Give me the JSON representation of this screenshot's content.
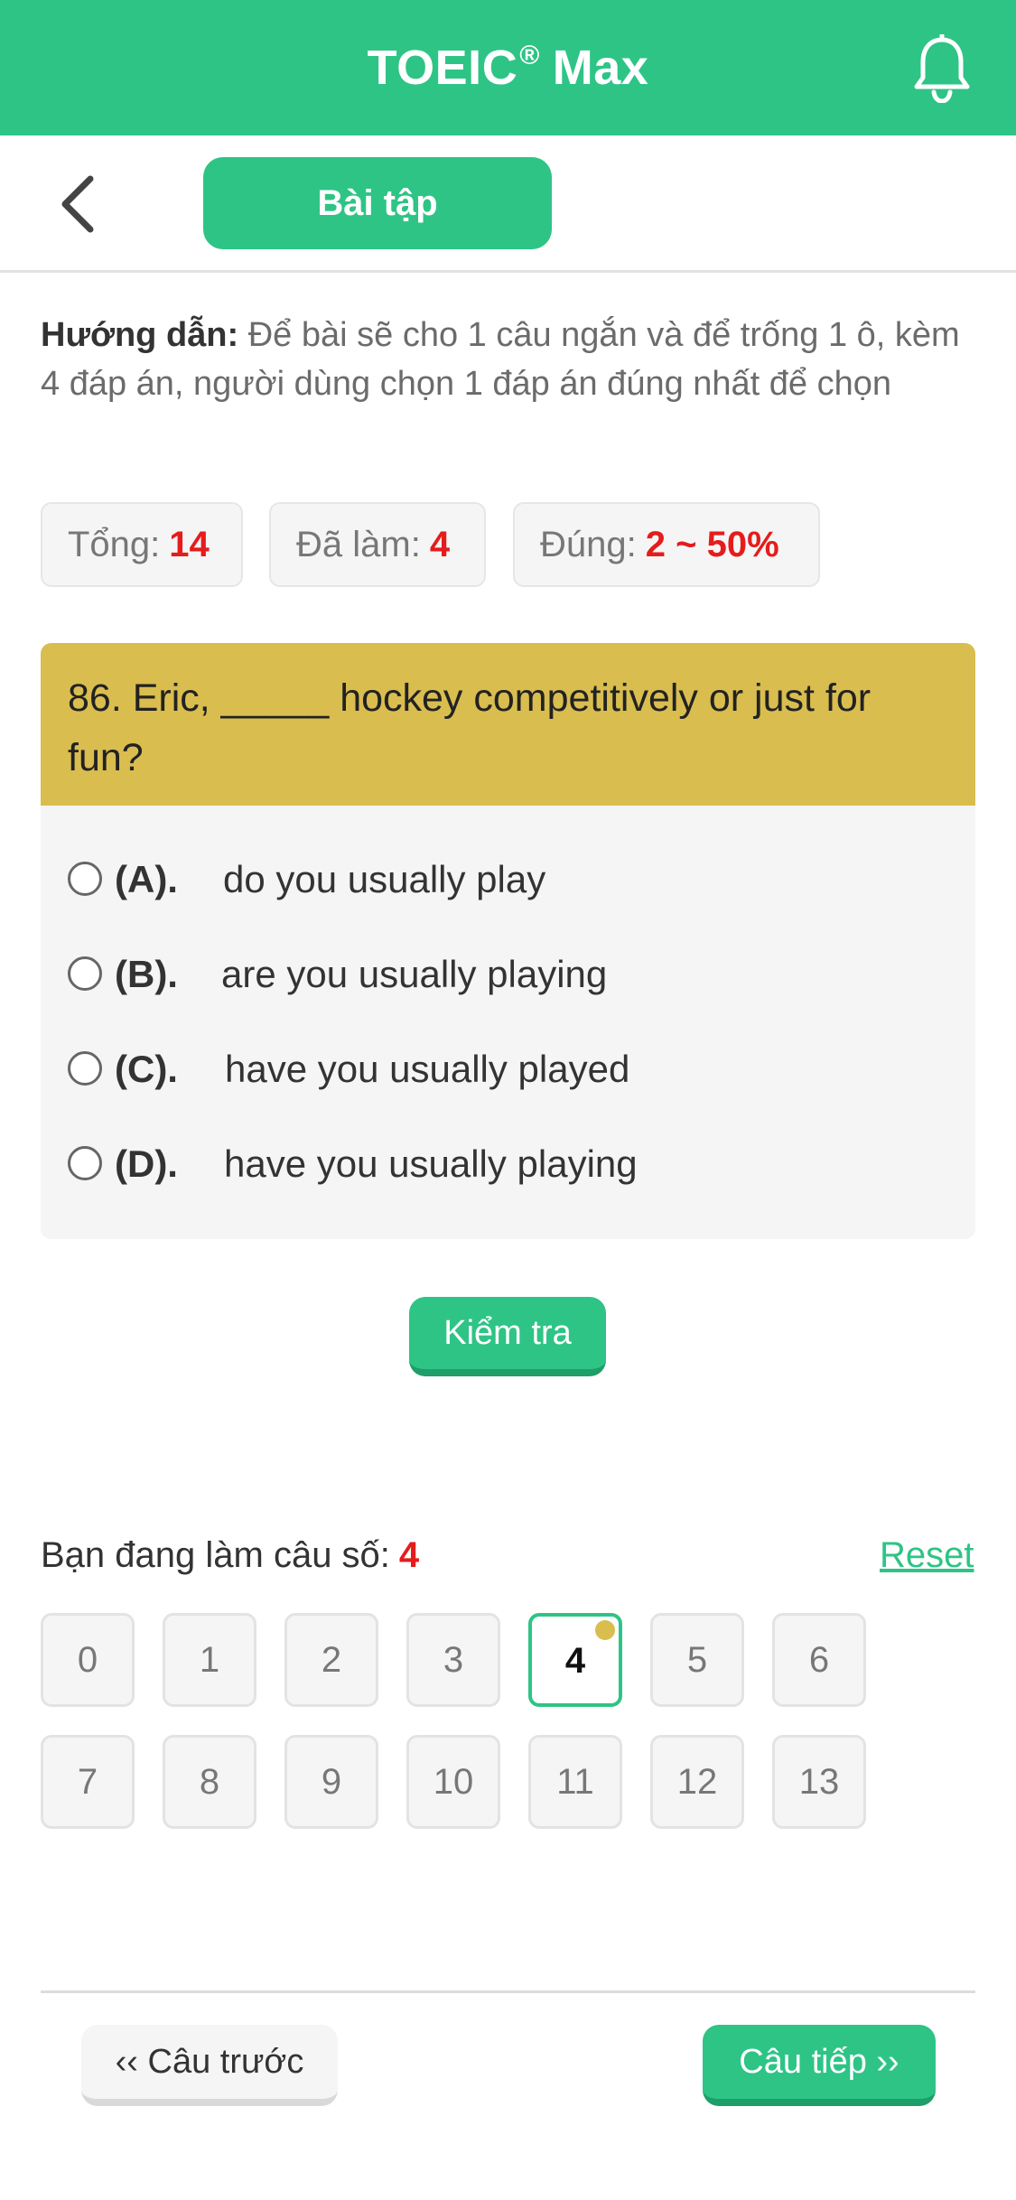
{
  "app": {
    "title_main": "TOEIC",
    "title_reg": "®",
    "title_suffix": "Max",
    "accent_color": "#2ec486",
    "question_header_color": "#d9bd4f",
    "highlight_color": "#e51c1c"
  },
  "header": {
    "tab_label": "Bài tập"
  },
  "instructions": {
    "label": "Hướng dẫn:",
    "text": "Để bài sẽ cho 1 câu ngắn và để trống 1 ô, kèm 4 đáp án, người dùng chọn 1 đáp án đúng nhất để chọn"
  },
  "stats": [
    {
      "label": "Tổng:",
      "value": "14"
    },
    {
      "label": "Đã làm:",
      "value": "4"
    },
    {
      "label": "Đúng:",
      "value": "2 ~ 50%"
    }
  ],
  "question": {
    "text": "86. Eric, _____ hockey competitively or just for fun?",
    "options": [
      {
        "label": "(A).",
        "text": "do you usually play"
      },
      {
        "label": "(B).",
        "text": "are you usually playing"
      },
      {
        "label": "(C).",
        "text": "have you usually played"
      },
      {
        "label": "(D).",
        "text": "have you usually playing"
      }
    ]
  },
  "check_button": "Kiểm tra",
  "progress": {
    "current_label": "Bạn đang làm câu số:",
    "current_value": "4",
    "reset_label": "Reset",
    "numbers": [
      "0",
      "1",
      "2",
      "3",
      "4",
      "5",
      "6",
      "7",
      "8",
      "9",
      "10",
      "11",
      "12",
      "13"
    ],
    "active_index": 4
  },
  "nav": {
    "prev_label": "‹‹ Câu trước",
    "next_label": "Câu tiếp ››"
  }
}
